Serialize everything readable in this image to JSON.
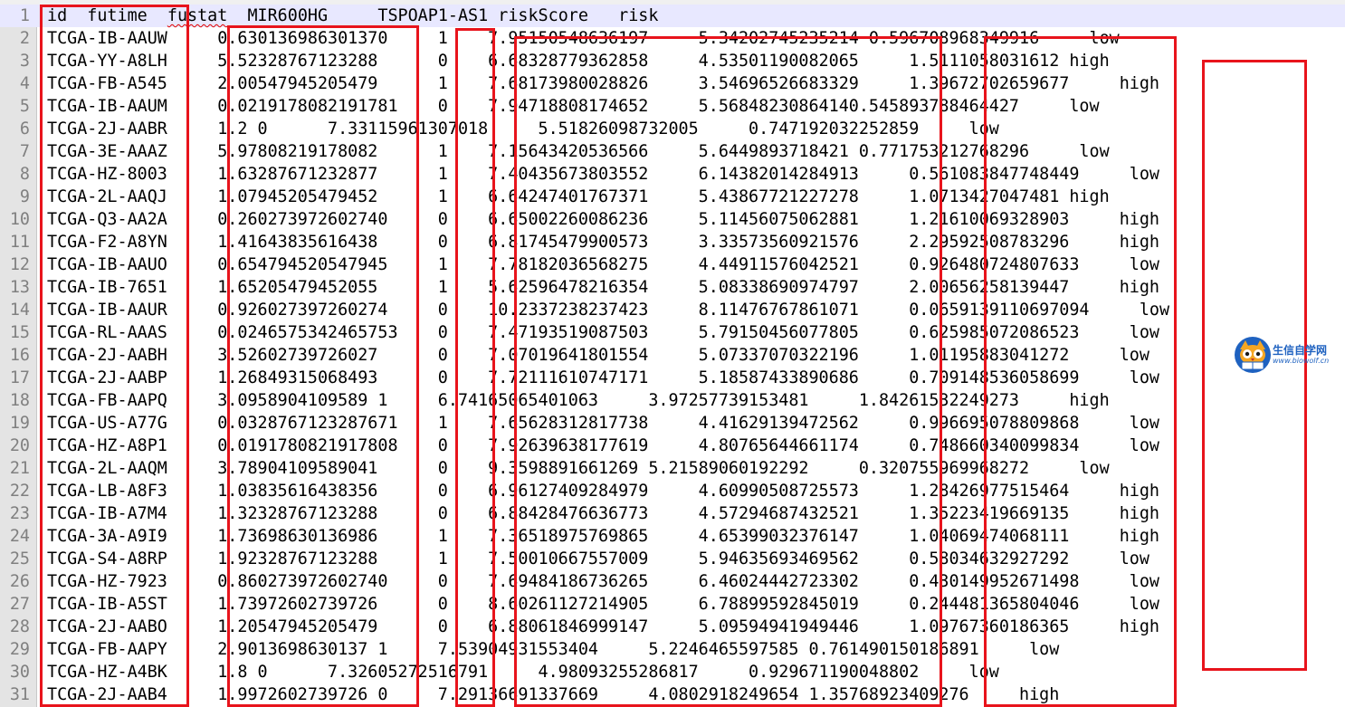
{
  "editor": {
    "lines": [
      {
        "n": "1",
        "prefix": "id  futime  ",
        "flag": "fustat",
        "suffix": "  MIR600HG     TSPOAP1-AS1 riskScore   risk"
      },
      {
        "n": "2",
        "text": "TCGA-IB-AAUW     0.630136986301370     1    7.95150548636197     5.34202745235214 0.596708968349916     low"
      },
      {
        "n": "3",
        "text": "TCGA-YY-A8LH     5.52328767123288      0    6.68328779362858     4.53501190082065     1.5111058031612 high"
      },
      {
        "n": "4",
        "text": "TCGA-FB-A545     2.00547945205479      1    7.68173980028826     3.54696526683329     1.39672702659677     high"
      },
      {
        "n": "5",
        "text": "TCGA-IB-AAUM     0.0219178082191781    0    7.94718808174652     5.56848230864140.545893788464427     low"
      },
      {
        "n": "6",
        "text": "TCGA-2J-AABR     1.2 0      7.33115961307018     5.51826098732005     0.747192032252859     low"
      },
      {
        "n": "7",
        "text": "TCGA-3E-AAAZ     5.97808219178082      1    7.15643420536566     5.6449893718421 0.771753212768296     low"
      },
      {
        "n": "8",
        "text": "TCGA-HZ-8003     1.63287671232877      1    7.40435673803552     6.14382014284913     0.561083847748449     low"
      },
      {
        "n": "9",
        "text": "TCGA-2L-AAQJ     1.07945205479452      1    6.64247401767371     5.43867721227278     1.0713427047481 high"
      },
      {
        "n": "10",
        "text": "TCGA-Q3-AA2A     0.260273972602740     0    6.65002260086236     5.11456075062881     1.21610069328903     high"
      },
      {
        "n": "11",
        "text": "TCGA-F2-A8YN     1.41643835616438      0    6.81745479900573     3.33573560921576     2.29592508783296     high"
      },
      {
        "n": "12",
        "text": "TCGA-IB-AAUO     0.654794520547945     1    7.78182036568275     4.44911576042521     0.926480724807633     low"
      },
      {
        "n": "13",
        "text": "TCGA-IB-7651     1.65205479452055      1    5.62596478216354     5.08338690974797     2.00656258139447     high"
      },
      {
        "n": "14",
        "text": "TCGA-IB-AAUR     0.926027397260274     0    10.2337238237423     8.11476767861071     0.0659139110697094     low"
      },
      {
        "n": "15",
        "text": "TCGA-RL-AAAS     0.0246575342465753    0    7.47193519087503     5.79150456077805     0.625985072086523     low"
      },
      {
        "n": "16",
        "text": "TCGA-2J-AABH     3.52602739726027      0    7.07019641801554     5.07337070322196     1.01195883041272     low"
      },
      {
        "n": "17",
        "text": "TCGA-2J-AABP     1.26849315068493      0    7.72111610747171     5.18587433890686     0.709148536058699     low"
      },
      {
        "n": "18",
        "text": "TCGA-FB-AAPQ     3.0958904109589 1     6.74165065401063     3.97257739153481     1.84261532249273     high"
      },
      {
        "n": "19",
        "text": "TCGA-US-A77G     0.0328767123287671    1    7.65628312817738     4.41629139472562     0.996695078809868     low"
      },
      {
        "n": "20",
        "text": "TCGA-HZ-A8P1     0.0191780821917808    0    7.92639638177619     4.80765644661174     0.748660340099834     low"
      },
      {
        "n": "21",
        "text": "TCGA-2L-AAQM     3.78904109589041      0    9.3598891661269 5.21589060192292     0.320755969968272     low"
      },
      {
        "n": "22",
        "text": "TCGA-LB-A8F3     1.03835616438356      0    6.96127409284979     4.60990508725573     1.28426977515464     high"
      },
      {
        "n": "23",
        "text": "TCGA-IB-A7M4     1.32328767123288      0    6.88428476636773     4.57294687432521     1.35223419669135     high"
      },
      {
        "n": "24",
        "text": "TCGA-3A-A9I9     1.73698630136986      1    7.36518975769865     4.65399032376147     1.04069474068111     high"
      },
      {
        "n": "25",
        "text": "TCGA-S4-A8RP     1.92328767123288      1    7.50010667557009     5.94635693469562     0.58034632927292     low"
      },
      {
        "n": "26",
        "text": "TCGA-HZ-7923     0.860273972602740     0    7.69484186736265     6.46024442723302     0.430149952671498     low"
      },
      {
        "n": "27",
        "text": "TCGA-IB-A5ST     1.73972602739726      0    8.60261127214905     6.78899592845019     0.244481365804046     low"
      },
      {
        "n": "28",
        "text": "TCGA-2J-AABO     1.20547945205479      0    6.88061846999147     5.09594941949446     1.09767360186365     high"
      },
      {
        "n": "29",
        "text": "TCGA-FB-AAPY     2.9013698630137 1     7.53904931553404     5.2246465597585 0.761490150186891     low"
      },
      {
        "n": "30",
        "text": "TCGA-HZ-A4BK     1.8 0      7.32605272516791     4.98093255286817     0.929671190048802     low"
      },
      {
        "n": "31",
        "text": "TCGA-2J-AAB4     1.9972602739726 0     7.29136691337669     4.0802918249654 1.35768923409276     high"
      }
    ]
  },
  "watermark": {
    "title": "生信自学网",
    "url": "www.biowolf.cn"
  },
  "colors": {
    "highlight_box": "#e8141c",
    "current_line": "#e8e8ff",
    "gutter": "#e4e4e4",
    "logo_blue": "#1f62c0"
  }
}
